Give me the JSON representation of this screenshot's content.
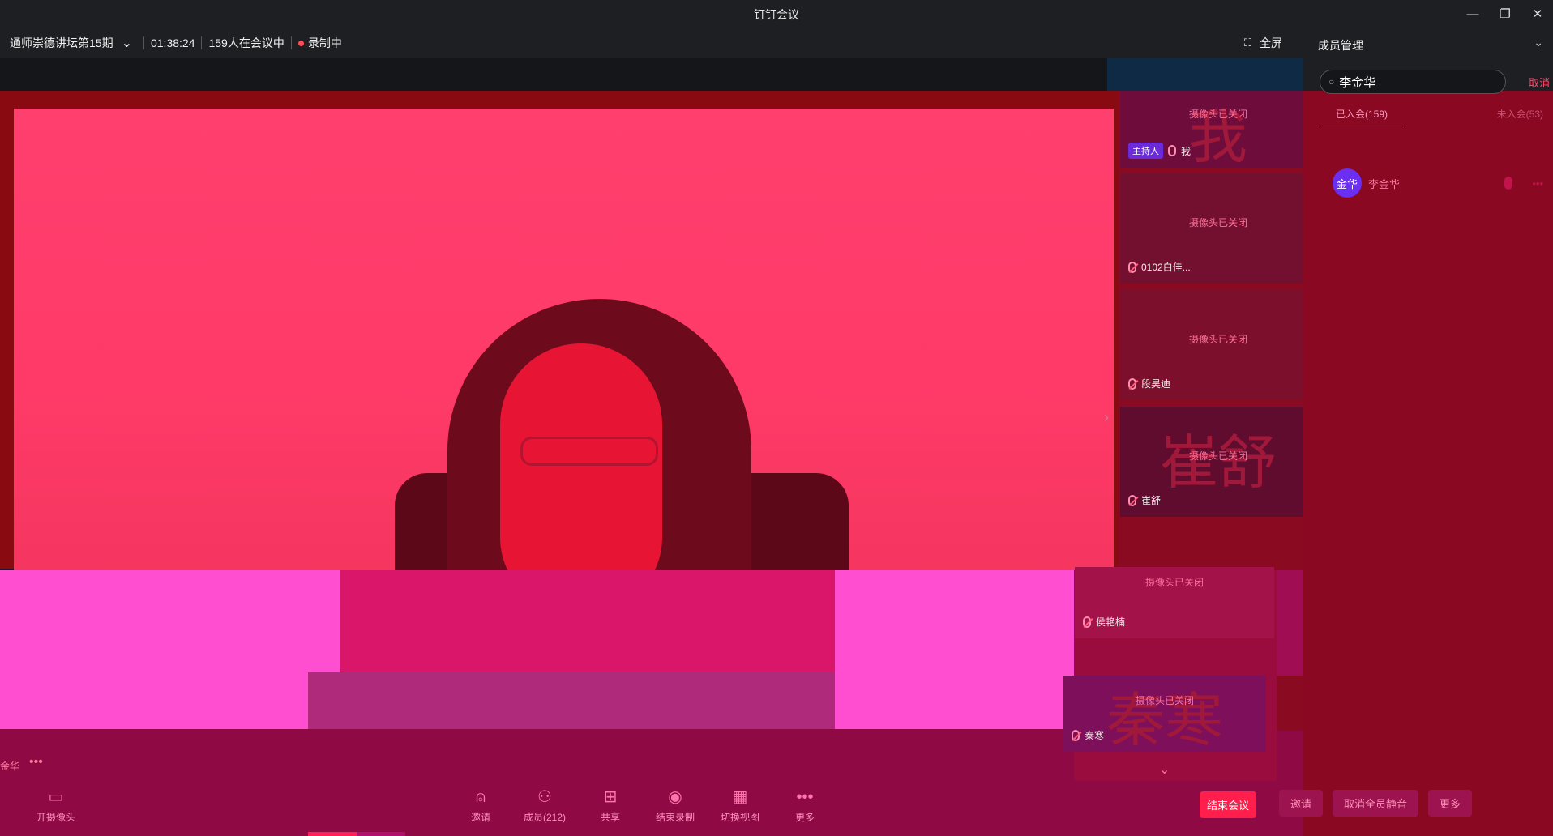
{
  "window": {
    "title": "钉钉会议",
    "minimize": "—",
    "restore": "❐",
    "close": "✕"
  },
  "meeting": {
    "name": "通师崇德讲坛第15期",
    "elapsed": "01:38:24",
    "participants_status": "159人在会议中",
    "recording_status": "录制中",
    "fullscreen_label": "全屏"
  },
  "thumbnails": [
    {
      "big_text": "我",
      "camera_status": "摄像头已关闭",
      "host_badge": "主持人",
      "name": "我"
    },
    {
      "big_text": "",
      "camera_status": "摄像头已关闭",
      "name": "0102白佳..."
    },
    {
      "big_text": "",
      "camera_status": "摄像头已关闭",
      "name": "段昊迪"
    },
    {
      "big_text": "崔舒",
      "camera_status": "摄像头已关闭",
      "name": "崔舒"
    },
    {
      "big_text": "",
      "camera_status": "摄像头已关闭",
      "name": "侯艳楠"
    },
    {
      "big_text": "秦寒",
      "camera_status": "摄像头已关闭",
      "name": "秦寒"
    }
  ],
  "speaker": {
    "name": "金华"
  },
  "panel": {
    "title": "成员管理",
    "search_value": "李金华",
    "cancel_label": "取消",
    "tab_joined": "已入会(159)",
    "tab_not_joined": "未入会(53)",
    "members": [
      {
        "avatar_text": "金华",
        "name": "李金华"
      }
    ],
    "actions": {
      "invite": "邀请",
      "unmute_all": "取消全员静音",
      "more": "更多"
    }
  },
  "toolbar": {
    "camera": "开摄像头",
    "invite": "邀请",
    "members": "成员(212)",
    "share": "共享",
    "end_recording": "结束录制",
    "switch_view": "切换视图",
    "more": "更多",
    "end_meeting": "结束会议"
  },
  "icons": {
    "camera": "▭",
    "invite": "⍝",
    "members": "⚇",
    "share": "⊞",
    "record": "◉",
    "view": "▦",
    "more": "•••",
    "chevron": "⌄",
    "next": "›",
    "down": "⌄",
    "search": "○"
  },
  "colors": {
    "accent": "#ff1e4c",
    "stage_tint": "#ff3f6e",
    "panel_bg": "#8a0822",
    "host_badge": "#6b2bd9"
  }
}
